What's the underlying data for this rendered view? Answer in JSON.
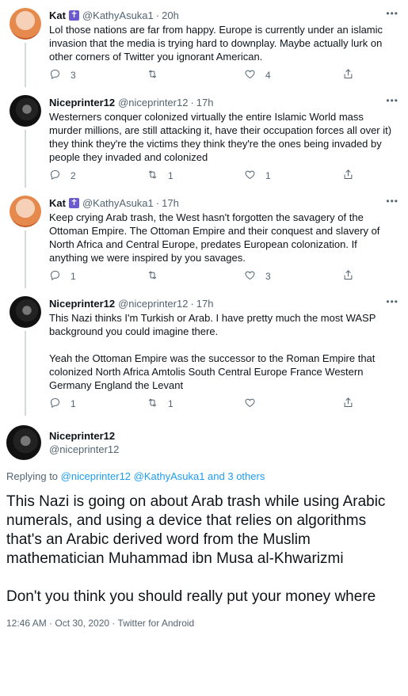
{
  "tweets": [
    {
      "name": "Kat",
      "has_badge": true,
      "badge_icon": "cross-icon",
      "handle": "@KathyAsuka1",
      "time": "20h",
      "text": [
        "Lol those nations are far from happy. Europe is currently under an islamic invasion that the media is trying hard to downplay. Maybe actually lurk on other corners of Twitter you ignorant American."
      ],
      "replies": "3",
      "retweets": "",
      "likes": "4"
    },
    {
      "name": "Niceprinter12",
      "has_badge": false,
      "handle": "@niceprinter12",
      "time": "17h",
      "text": [
        "Westerners  conquer colonized virtually the entire Islamic World mass murder millions, are still attacking it, have their occupation forces all over it) they think they're the victims they think they're the ones being invaded by people they invaded and colonized"
      ],
      "replies": "2",
      "retweets": "1",
      "likes": "1"
    },
    {
      "name": "Kat",
      "has_badge": true,
      "badge_icon": "cross-icon",
      "handle": "@KathyAsuka1",
      "time": "17h",
      "text": [
        "Keep crying Arab trash, the West hasn't forgotten the savagery of the Ottoman Empire. The Ottoman Empire and their conquest and slavery of North Africa and Central Europe, predates European colonization. If anything we were inspired by you savages."
      ],
      "replies": "1",
      "retweets": "",
      "likes": "3"
    },
    {
      "name": "Niceprinter12",
      "has_badge": false,
      "handle": "@niceprinter12",
      "time": "17h",
      "text": [
        "This Nazi thinks I'm Turkish or Arab. I have pretty much the most WASP background you could imagine there.",
        "Yeah the Ottoman Empire was the successor to the Roman Empire that colonized North Africa Amtolis South  Central Europe France Western Germany England the Levant"
      ],
      "replies": "1",
      "retweets": "1",
      "likes": ""
    }
  ],
  "main": {
    "name": "Niceprinter12",
    "handle": "@niceprinter12",
    "replying_prefix": "Replying to",
    "replying_to": "@niceprinter12 @KathyAsuka1 and 3 others",
    "text": [
      "This Nazi is going on about Arab trash while using Arabic numerals, and using a device that relies on algorithms that's an Arabic derived word from the Muslim mathematician Muhammad ibn Musa al-Khwarizmi",
      "Don't you think you should really put your money where"
    ],
    "meta": "12:46 AM · Oct 30, 2020 · Twitter for Android"
  },
  "ui": {
    "more_glyph": "•••",
    "dot": "·",
    "cross_glyph": "✝"
  }
}
